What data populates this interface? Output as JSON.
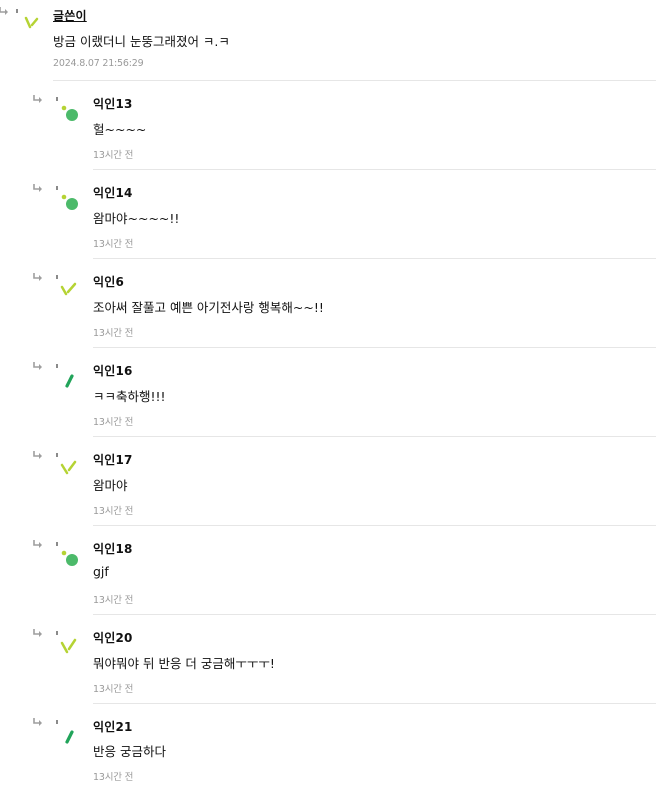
{
  "op": {
    "nick": "글쓴이",
    "body": "방금 이랬더니 눈뚱그래졌어 ㅋ.ㅋ",
    "time": "2024.8.07 21:56:29",
    "avatar_icon": "tilted-stick-avatar-icon"
  },
  "replies": [
    {
      "nick": "익인13",
      "body": "헐~~~~",
      "time": "13시간 전",
      "avatar_icon": "green-dot-avatar-icon"
    },
    {
      "nick": "익인14",
      "body": "왐마야~~~~!!",
      "time": "13시간 전",
      "avatar_icon": "green-dot-avatar-icon"
    },
    {
      "nick": "익인6",
      "body": "조아써 잘풀고 예쁜 아기전사랑 행복해~~!!",
      "time": "13시간 전",
      "avatar_icon": "tilted-stick-avatar-icon"
    },
    {
      "nick": "익인16",
      "body": "ㅋㅋ축하행!!!",
      "time": "13시간 전",
      "avatar_icon": "dark-stick-avatar-icon"
    },
    {
      "nick": "익인17",
      "body": "왐마야",
      "time": "13시간 전",
      "avatar_icon": "tilted-stick-avatar-icon"
    },
    {
      "nick": "익인18",
      "body": "gjf",
      "time": "13시간 전",
      "avatar_icon": "green-dot-avatar-icon"
    },
    {
      "nick": "익인20",
      "body": "뭐야뭐야 뒤 반응 더 궁금해ㅜㅜㅜ!",
      "time": "13시간 전",
      "avatar_icon": "tilted-stick-avatar-icon"
    },
    {
      "nick": "익인21",
      "body": "반응 궁금하다",
      "time": "13시간 전",
      "avatar_icon": "dark-stick-avatar-icon"
    }
  ],
  "colors": {
    "lime": "#b5d334",
    "green": "#4cba6a",
    "dark_green": "#21a45a",
    "arrow": "#9e9e9e",
    "divider": "#e6e6e6",
    "time": "#9a9a9a"
  }
}
